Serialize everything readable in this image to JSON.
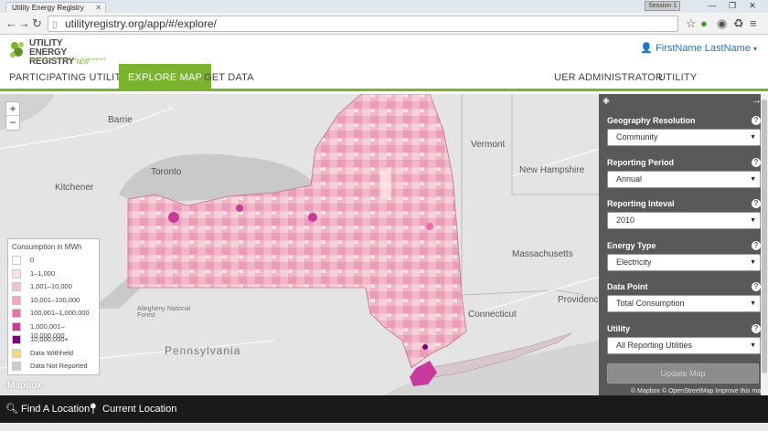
{
  "browser": {
    "tab_title": "Utility Energy Registry",
    "version_badge": "Session 1",
    "url": "utilityregistry.org/app/#/explore/"
  },
  "header": {
    "logo_line1": "UTILITY ENERGY",
    "logo_line2": "REGISTRY",
    "logo_ny": "NEW YORK",
    "logo_tagline": "SUPPORTING SUSTAINABLE COMMUNITIES",
    "user_name": "FirstName LastName"
  },
  "nav": {
    "items": [
      "PARTICIPATING UTILITIES",
      "EXPLORE MAP",
      "GET DATA"
    ],
    "right_items": [
      "UER ADMINISTRATOR",
      "UTILITY ADMINISTRATOR"
    ]
  },
  "map": {
    "zoom_in": "+",
    "zoom_out": "−",
    "labels": {
      "barrie": "Barrie",
      "toronto": "Toronto",
      "kitchener": "Kitchener",
      "vermont": "Vermont",
      "new_hampshire": "New Hampshire",
      "massachusetts": "Massachusetts",
      "connecticut": "Connecticut",
      "providence": "Providence",
      "pennsylvania": "Pennsylvania",
      "allegheny": "Allegheny National Forest",
      "mapbox": "Mapbox"
    },
    "legend": {
      "title": "Consumption in MWh",
      "entries": [
        {
          "label": "0",
          "color": "#ffffff"
        },
        {
          "label": "1–1,000",
          "color": "#fde0dd"
        },
        {
          "label": "1,001–10,000",
          "color": "#fbc4c4"
        },
        {
          "label": "10,001–100,000",
          "color": "#f6a3bf"
        },
        {
          "label": "100,001–1,000,000",
          "color": "#e86fb0"
        },
        {
          "label": "1,000,001–10,000,000",
          "color": "#c83b9c"
        },
        {
          "label": "10,000,000+",
          "color": "#7a0177"
        },
        {
          "label": "Data Withheld",
          "color": "#f8d87a"
        },
        {
          "label": "Data Not Reported",
          "color": "#cccccc"
        }
      ]
    }
  },
  "sidebar": {
    "fields": [
      {
        "label": "Geography Resolution",
        "value": "Community"
      },
      {
        "label": "Reporting Period",
        "value": "Annual"
      },
      {
        "label": "Reporting Inteval",
        "value": "2010"
      },
      {
        "label": "Energy Type",
        "value": "Electricity"
      },
      {
        "label": "Data Point",
        "value": "Total Consumption"
      },
      {
        "label": "Utility",
        "value": "All Reporting Utilities"
      }
    ],
    "help_glyph": "?",
    "update_button": "Update Map",
    "attribution": "© Mapbox © OpenStreetMap Improve this map"
  },
  "bottom": {
    "find_location": "Find A Location",
    "current_location": "Current Location"
  }
}
